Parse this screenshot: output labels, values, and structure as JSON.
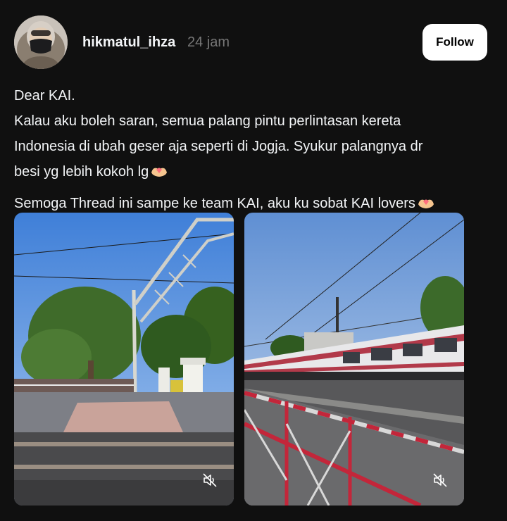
{
  "post": {
    "username": "hikmatul_ihza",
    "timestamp": "24 jam",
    "follow_label": "Follow",
    "text_lines": [
      "Dear KAI.",
      "Kalau aku boleh saran, semua palang pintu perlintasan kereta",
      "Indonesia di ubah geser aja seperti di Jogja. Syukur palangnya dr",
      "besi yg lebih kokoh lg"
    ],
    "text_line_2": "Semoga Thread ini sampe ke team KAI, aku ku sobat KAI lovers",
    "emoji": "heart-hands-emoji",
    "media": [
      {
        "icon": "video-muted-icon"
      },
      {
        "icon": "video-muted-icon"
      }
    ]
  },
  "colors": {
    "background": "#101010",
    "text": "#f3f5f7",
    "secondary": "#777777",
    "follow_bg": "#ffffff",
    "follow_text": "#000000"
  }
}
